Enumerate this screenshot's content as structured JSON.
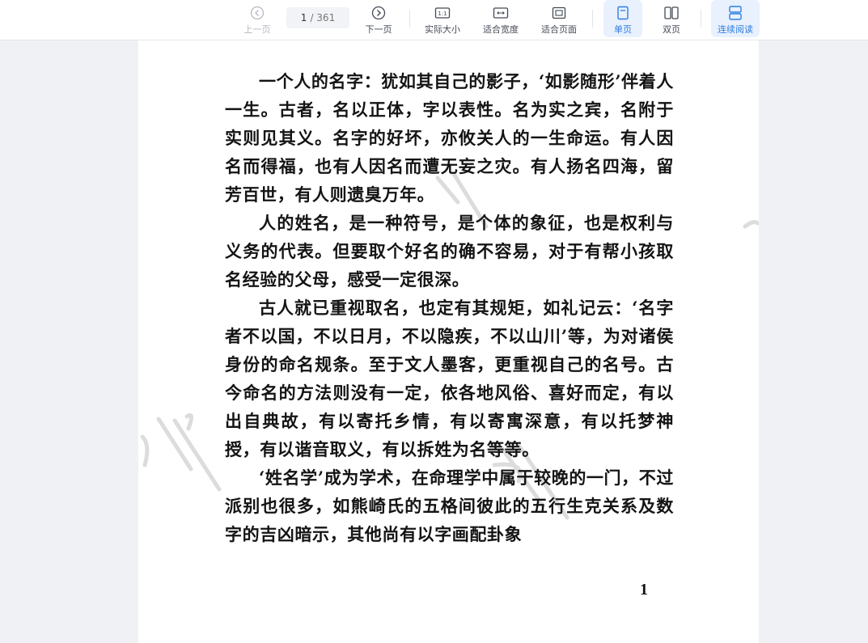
{
  "toolbar": {
    "prev_page": "上一页",
    "next_page": "下一页",
    "current_page": "1",
    "total_pages": "/ 361",
    "actual_size": "实际大小",
    "fit_width": "适合宽度",
    "fit_page": "适合页面",
    "single_page": "单页",
    "double_page": "双页",
    "continuous": "连续阅读",
    "actual_size_glyph": "1:1"
  },
  "colors": {
    "accent": "#2f7de1",
    "active_bg": "#e8f1fd",
    "disabled": "#b5b9c2"
  },
  "document": {
    "paragraphs": [
      "一个人的名字：犹如其自己的影子，‘如影随形’伴着人一生。古者，名以正体，字以表性。名为实之宾，名附于实则见其义。名字的好坏，亦攸关人的一生命运。有人因名而得福，也有人因名而遭无妄之灾。有人扬名四海，留芳百世，有人则遗臭万年。",
      "人的姓名，是一种符号，是个体的象征，也是权利与义务的代表。但要取个好名的确不容易，对于有帮小孩取名经验的父母，感受一定很深。",
      "古人就已重视取名，也定有其规矩，如礼记云：‘名字者不以国，不以日月，不以隐疾，不以山川’等，为对诸侯身份的命名规条。至于文人墨客，更重视自己的名号。古今命名的方法则没有一定，依各地风俗、喜好而定，有以出自典故，有以寄托乡情，有以寄寓深意，有以托梦神授，有以谐音取义，有以拆姓为名等等。",
      "‘姓名学’成为学术，在命理学中属于较晚的一门，不过派别也很多，如熊崎氏的五格间彼此的五行生克关系及数字的吉凶暗示，其他尚有以字画配卦象"
    ],
    "page_number": "1"
  }
}
